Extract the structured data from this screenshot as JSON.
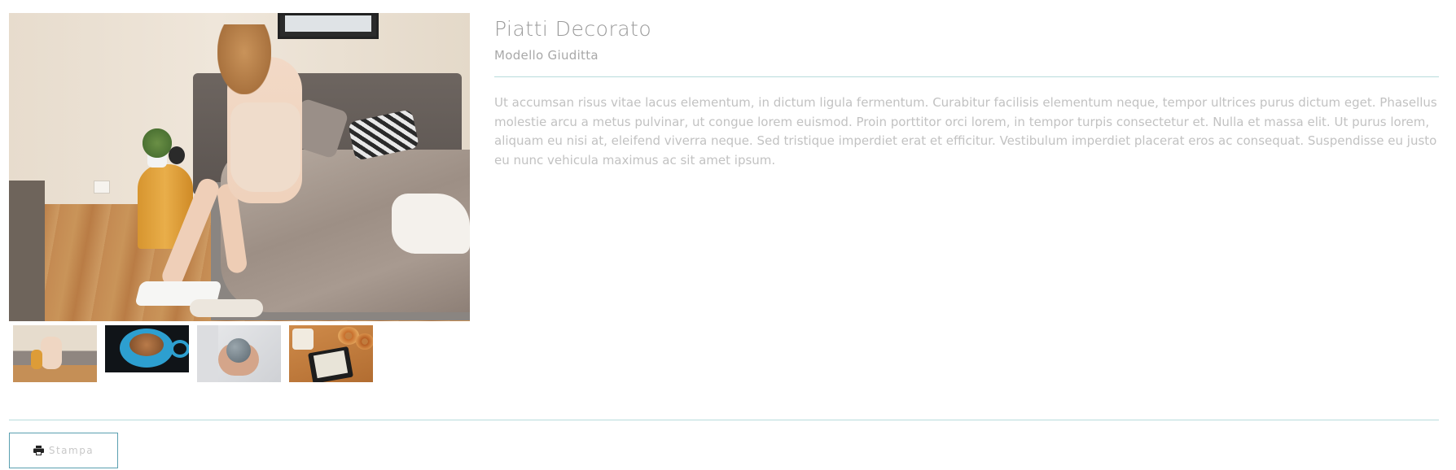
{
  "product": {
    "title": "Piatti Decorato",
    "subtitle": "Modello Giuditta",
    "description": "Ut accumsan risus vitae lacus elementum, in dictum ligula fermentum. Curabitur facilisis elementum neque, tempor ultrices purus dictum eget. Phasellus molestie arcu a metus pulvinar, ut congue lorem euismod. Proin porttitor orci lorem, in tempor turpis consectetur et. Nulla et massa elit. Ut purus lorem, aliquam eu nisi at, eleifend viverra neque. Sed tristique imperdiet erat et efficitur. Vestibulum imperdiet placerat eros ac consequat. Suspendisse eu justo eu nunc vehicula maximus ac sit amet ipsum."
  },
  "gallery": {
    "main_image": "woman-stretching-on-bed",
    "thumbnails": [
      "woman-on-bed",
      "blue-coffee-cup",
      "hands-holding-ball",
      "e-reader-with-donuts"
    ]
  },
  "actions": {
    "print_label": "Stampa",
    "print_icon": "printer-icon"
  },
  "colors": {
    "divider": "#b8dcdc",
    "button_border": "#5a9fb0",
    "text_muted": "#c2c2c2"
  }
}
